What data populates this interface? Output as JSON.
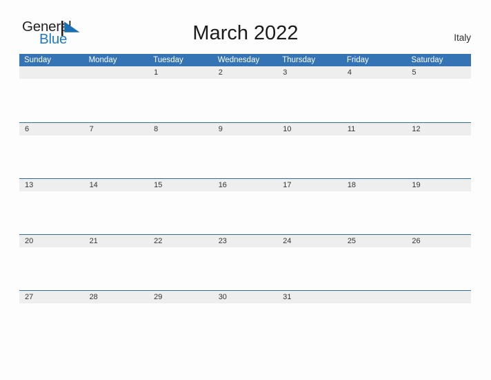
{
  "brand": {
    "word_one": "General",
    "word_two": "Blue",
    "mark_icon": "triangle-flag-icon",
    "accent_color": "#1b7ac2"
  },
  "header": {
    "title": "March 2022",
    "country": "Italy"
  },
  "theme": {
    "header_blue": "#3473b4",
    "row_band_gray": "#eeeeee",
    "row_border_blue": "#2e6da4",
    "page_background": "#fdfdfd",
    "title_color": "#1a1a1a"
  },
  "calendar": {
    "month": "March",
    "year": "2022",
    "weekday_headers": [
      "Sunday",
      "Monday",
      "Tuesday",
      "Wednesday",
      "Thursday",
      "Friday",
      "Saturday"
    ],
    "weeks": [
      [
        "",
        "",
        "1",
        "2",
        "3",
        "4",
        "5"
      ],
      [
        "6",
        "7",
        "8",
        "9",
        "10",
        "11",
        "12"
      ],
      [
        "13",
        "14",
        "15",
        "16",
        "17",
        "18",
        "19"
      ],
      [
        "20",
        "21",
        "22",
        "23",
        "24",
        "25",
        "26"
      ],
      [
        "27",
        "28",
        "29",
        "30",
        "31",
        "",
        ""
      ]
    ]
  }
}
